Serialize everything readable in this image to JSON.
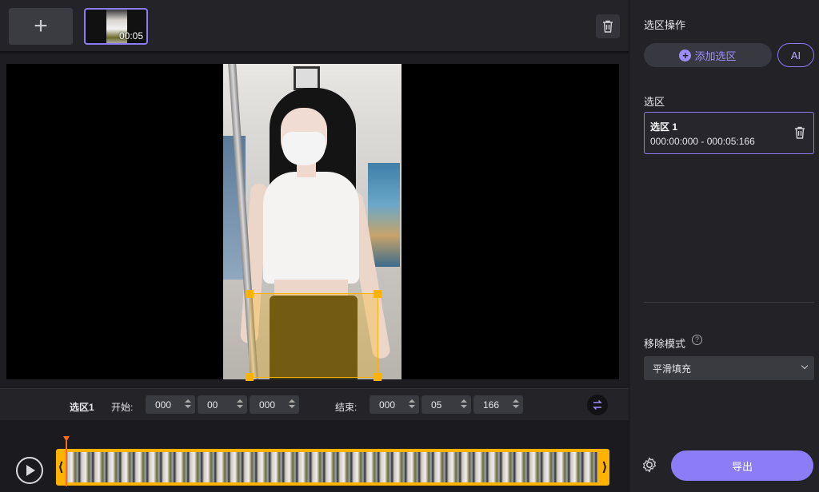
{
  "media": {
    "add_label": "+",
    "thumbnail_duration": "00:05"
  },
  "selection_bar": {
    "label": "选区1",
    "start_label": "开始:",
    "start": {
      "h": "000",
      "m": "00",
      "ms": "000"
    },
    "end_label": "结束:",
    "end": {
      "h": "000",
      "m": "05",
      "ms": "166"
    }
  },
  "side": {
    "ops_title": "选区操作",
    "add_selection": "添加选区",
    "ai": "AI",
    "selections_heading": "选区",
    "selections": [
      {
        "name": "选区 1",
        "range": "000:00:000 - 000:05:166"
      }
    ],
    "remove_mode_label": "移除模式",
    "remove_mode_value": "平滑填充",
    "export": "导出"
  },
  "colors": {
    "accent": "#8b7cf6",
    "selection": "#ffb300",
    "playhead": "#ff6a1a"
  }
}
